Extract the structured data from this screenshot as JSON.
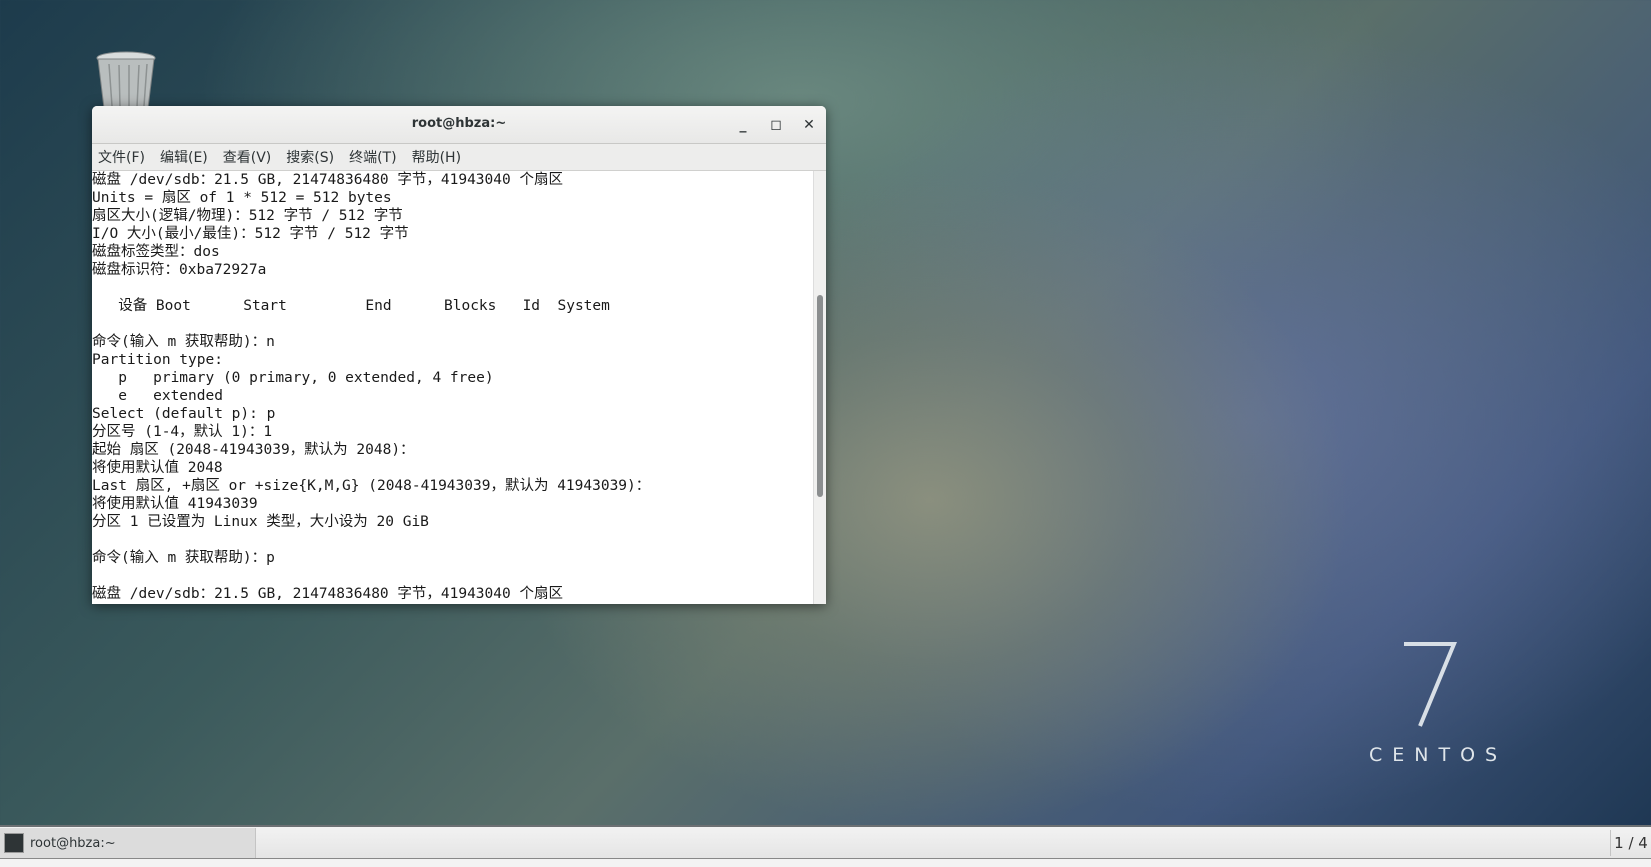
{
  "window": {
    "title": "root@hbza:~",
    "minimize_icon": "minimize-icon",
    "maximize_icon": "maximize-icon",
    "close_icon": "close-icon"
  },
  "menubar": [
    "文件(F)",
    "编辑(E)",
    "查看(V)",
    "搜索(S)",
    "终端(T)",
    "帮助(H)"
  ],
  "terminal_lines": [
    "磁盘 /dev/sdb：21.5 GB, 21474836480 字节，41943040 个扇区",
    "Units = 扇区 of 1 * 512 = 512 bytes",
    "扇区大小(逻辑/物理)：512 字节 / 512 字节",
    "I/O 大小(最小/最佳)：512 字节 / 512 字节",
    "磁盘标签类型：dos",
    "磁盘标识符：0xba72927a",
    "",
    "   设备 Boot      Start         End      Blocks   Id  System",
    "",
    "命令(输入 m 获取帮助)：n",
    "Partition type:",
    "   p   primary (0 primary, 0 extended, 4 free)",
    "   e   extended",
    "Select (default p): p",
    "分区号 (1-4，默认 1)：1",
    "起始 扇区 (2048-41943039，默认为 2048)：",
    "将使用默认值 2048",
    "Last 扇区, +扇区 or +size{K,M,G} (2048-41943039，默认为 41943039)：",
    "将使用默认值 41943039",
    "分区 1 已设置为 Linux 类型，大小设为 20 GiB",
    "",
    "命令(输入 m 获取帮助)：p",
    "",
    "磁盘 /dev/sdb：21.5 GB, 21474836480 字节，41943040 个扇区"
  ],
  "desktop": {
    "trash_icon": "trash-icon",
    "logo_number": "7",
    "logo_text": "CENTOS"
  },
  "taskbar": {
    "task_label": "root@hbza:~",
    "workspace": "1 / 4"
  }
}
